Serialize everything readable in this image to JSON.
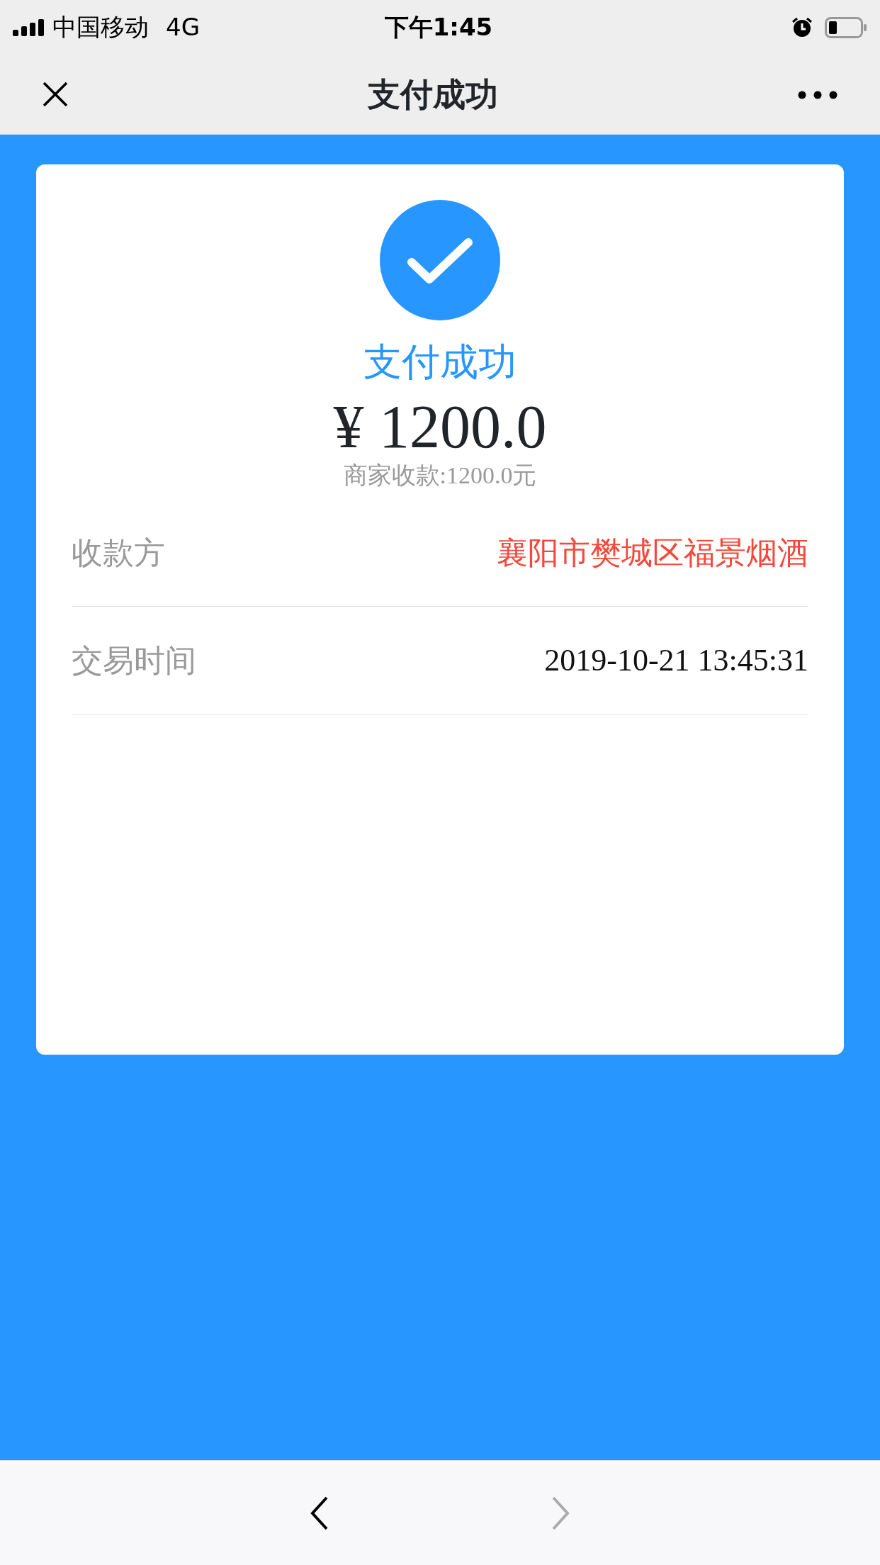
{
  "status_bar": {
    "carrier": "中国移动",
    "network": "4G",
    "time": "下午1:45"
  },
  "nav_bar": {
    "title": "支付成功"
  },
  "receipt": {
    "status": "支付成功",
    "amount": "¥ 1200.0",
    "merchant_amount": "商家收款:1200.0元",
    "rows": [
      {
        "label": "收款方",
        "value": "襄阳市樊城区福景烟酒",
        "kind": "highlight"
      },
      {
        "label": "交易时间",
        "value": "2019-10-21 13:45:31",
        "kind": "plain"
      }
    ]
  },
  "toolbar": {
    "buttons": [
      {
        "kind": "back",
        "disabled": false
      },
      {
        "kind": "forward",
        "disabled": true
      }
    ]
  }
}
